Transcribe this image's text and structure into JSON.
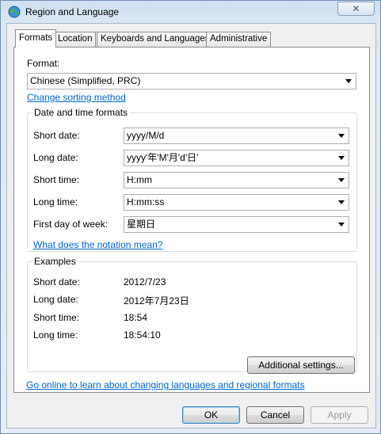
{
  "window": {
    "title": "Region and Language",
    "close_label": "✕"
  },
  "tabs": [
    {
      "label": "Formats",
      "active": true
    },
    {
      "label": "Location",
      "active": false
    },
    {
      "label": "Keyboards and Languages",
      "active": false
    },
    {
      "label": "Administrative",
      "active": false
    }
  ],
  "formats": {
    "format_label": "Format:",
    "format_value": "Chinese (Simplified, PRC)",
    "change_sorting_link": "Change sorting method"
  },
  "datetime": {
    "group_title": "Date and time formats",
    "short_date_label": "Short date:",
    "short_date_value": "yyyy/M/d",
    "long_date_label": "Long date:",
    "long_date_value": "yyyy'年'M'月'd'日'",
    "short_time_label": "Short time:",
    "short_time_value": "H:mm",
    "long_time_label": "Long time:",
    "long_time_value": "H:mm:ss",
    "first_day_label": "First day of week:",
    "first_day_value": "星期日",
    "notation_link": "What does the notation mean?"
  },
  "examples": {
    "group_title": "Examples",
    "short_date_label": "Short date:",
    "short_date_value": "2012/7/23",
    "long_date_label": "Long date:",
    "long_date_value": "2012年7月23日",
    "short_time_label": "Short time:",
    "short_time_value": "18:54",
    "long_time_label": "Long time:",
    "long_time_value": "18:54:10"
  },
  "buttons": {
    "additional_settings": "Additional settings...",
    "ok": "OK",
    "cancel": "Cancel",
    "apply": "Apply"
  },
  "online_link": "Go online to learn about changing languages and regional formats",
  "colors": {
    "link": "#0066cc",
    "panel": "#ffffff",
    "frame": "#dbe7f4"
  }
}
